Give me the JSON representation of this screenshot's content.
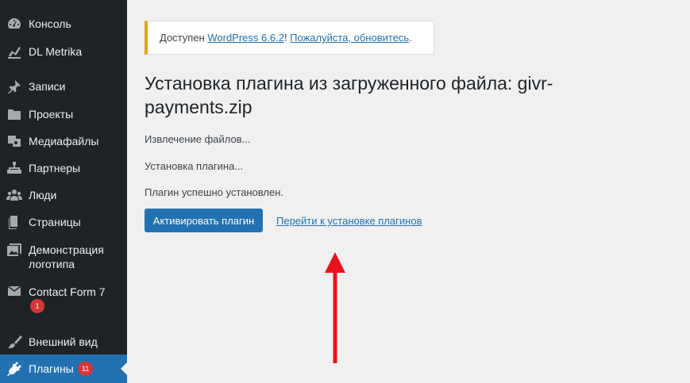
{
  "sidebar": {
    "items": [
      {
        "label": "Консоль",
        "icon": "dashboard-icon"
      },
      {
        "label": "DL Metrika",
        "icon": "chart-icon"
      },
      {
        "label": "Записи",
        "icon": "pin-icon"
      },
      {
        "label": "Проекты",
        "icon": "folder-icon"
      },
      {
        "label": "Медиафайлы",
        "icon": "media-icon"
      },
      {
        "label": "Партнеры",
        "icon": "hierarchy-icon"
      },
      {
        "label": "Люди",
        "icon": "people-icon"
      },
      {
        "label": "Страницы",
        "icon": "pages-icon"
      },
      {
        "label_line1": "Демонстрация",
        "label_line2": "логотипа",
        "icon": "gallery-icon"
      },
      {
        "label": "Contact Form 7",
        "badge": "1",
        "icon": "mail-icon"
      },
      {
        "label": "Внешний вид",
        "icon": "brush-icon"
      },
      {
        "label": "Плагины",
        "badge": "11",
        "icon": "plugin-icon",
        "active": true
      }
    ]
  },
  "notice": {
    "prefix": "Доступен ",
    "version_link": "WordPress 6.6.2",
    "middle": "! ",
    "update_link": "Пожалуйста, обновитесь",
    "suffix": "."
  },
  "page": {
    "title": "Установка плагина из загруженного файла: givr-payments.zip",
    "log": [
      "Извлечение файлов...",
      "Установка плагина...",
      "Плагин успешно установлен."
    ],
    "activate_button": "Активировать плагин",
    "go_to_install_link": "Перейти к установке плагинов"
  },
  "colors": {
    "sidebar_bg": "#1d2327",
    "active_item": "#2271b1",
    "badge": "#d63638",
    "notice_border": "#dba617",
    "annotation_arrow": "#e3141c"
  }
}
